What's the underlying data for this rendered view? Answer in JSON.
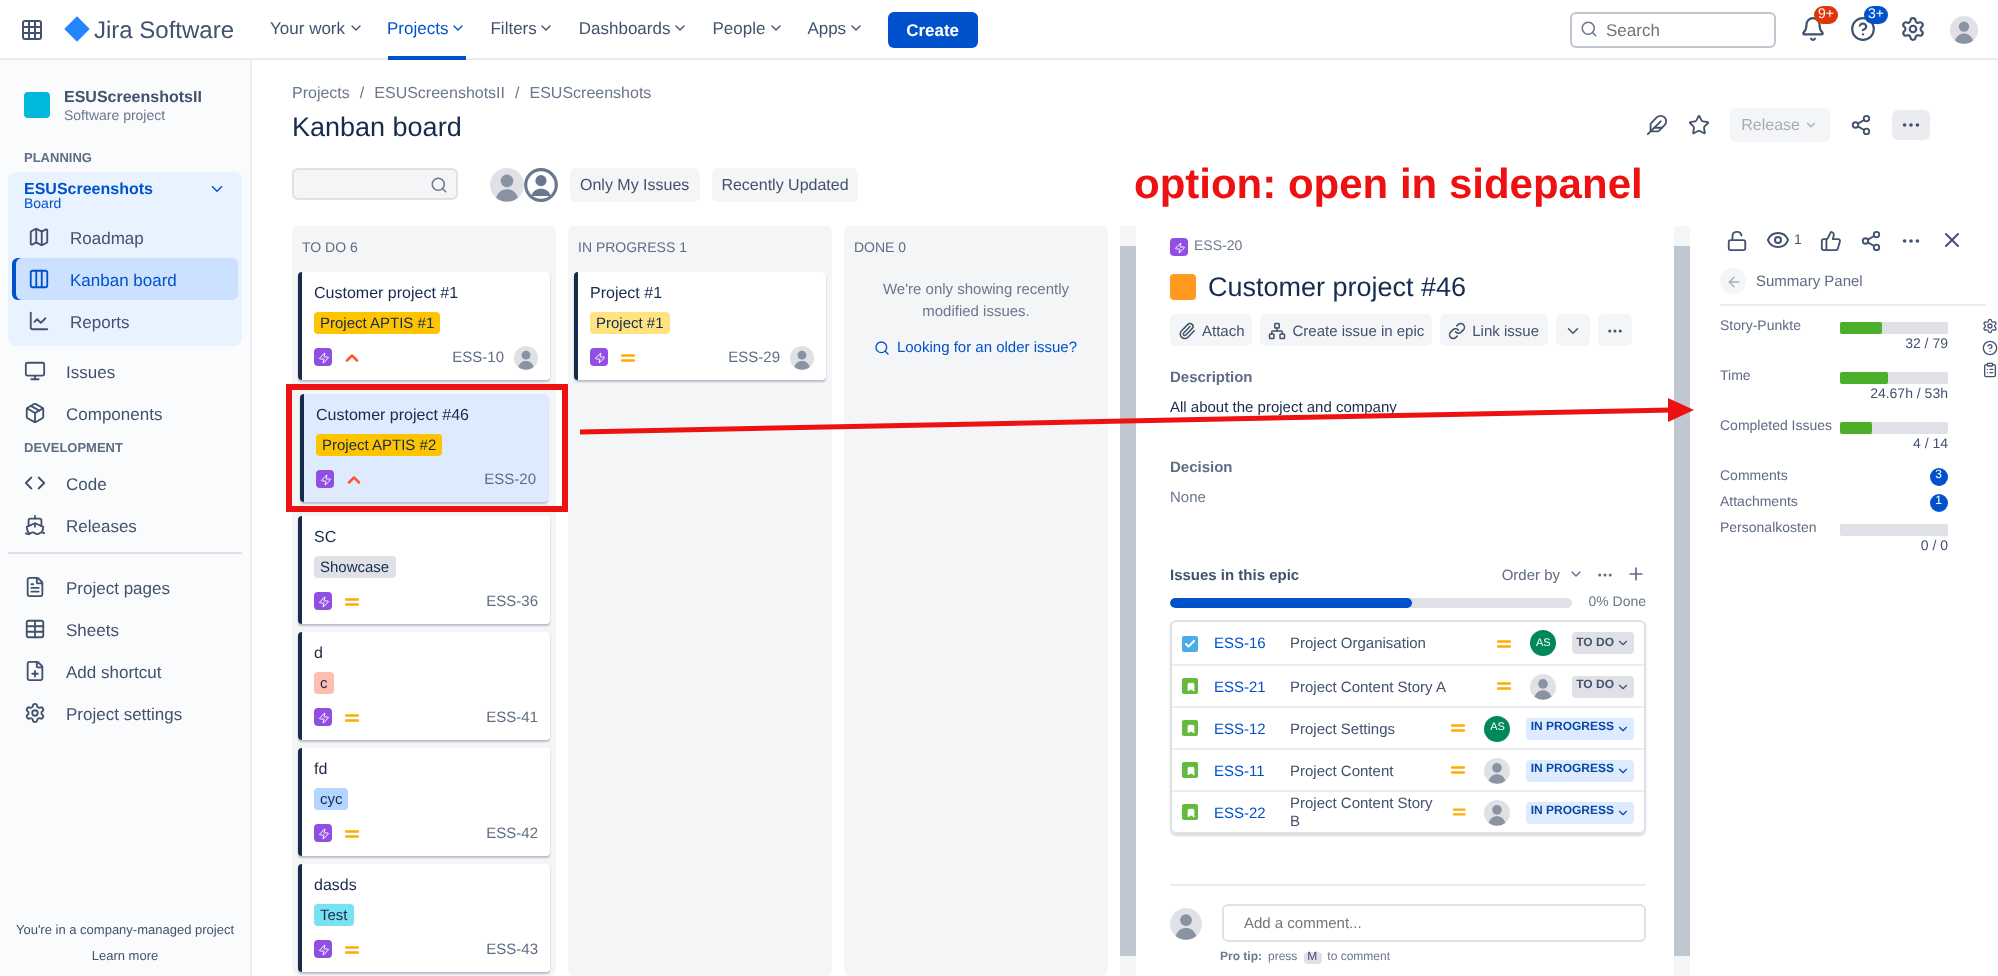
{
  "topnav": {
    "product": "Jira Software",
    "items": [
      {
        "label": "Your work",
        "selected": false
      },
      {
        "label": "Projects",
        "selected": true
      },
      {
        "label": "Filters",
        "selected": false
      },
      {
        "label": "Dashboards",
        "selected": false
      },
      {
        "label": "People",
        "selected": false
      },
      {
        "label": "Apps",
        "selected": false
      }
    ],
    "create": "Create",
    "search": {
      "placeholder": "Search"
    },
    "notifications_badge": "9+",
    "help_badge": "3+"
  },
  "sidebar": {
    "project": {
      "name": "ESUScreenshotsII",
      "type": "Software project"
    },
    "sections": [
      {
        "heading": "PLANNING",
        "group": {
          "title": "ESUScreenshots",
          "subtitle": "Board",
          "items": [
            {
              "label": "Roadmap",
              "selected": false
            },
            {
              "label": "Kanban board",
              "selected": true
            },
            {
              "label": "Reports",
              "selected": false
            }
          ]
        },
        "items": [
          {
            "label": "Issues",
            "selected": false
          },
          {
            "label": "Components",
            "selected": false
          }
        ]
      },
      {
        "heading": "DEVELOPMENT",
        "items": [
          {
            "label": "Code",
            "selected": false
          },
          {
            "label": "Releases",
            "selected": false
          }
        ]
      },
      {
        "items": [
          {
            "label": "Project pages",
            "selected": false
          },
          {
            "label": "Sheets",
            "selected": false
          },
          {
            "label": "Add shortcut",
            "selected": false
          },
          {
            "label": "Project settings",
            "selected": false
          }
        ]
      }
    ],
    "footer": {
      "text": "You're in a company-managed project",
      "link": "Learn more"
    }
  },
  "breadcrumbs": {
    "separator": "/",
    "items": [
      "Projects",
      "ESUScreenshotsII",
      "ESUScreenshots"
    ]
  },
  "title": "Kanban board",
  "header_actions": {
    "release": "Release"
  },
  "filters": [
    "Only My Issues",
    "Recently Updated"
  ],
  "annotation": {
    "text": "option: open in sidepanel"
  },
  "columns": [
    {
      "title": "TO DO 6",
      "cards": [
        {
          "title": "Customer project #1",
          "tag": {
            "label": "Project APTIS #1",
            "color": "#ffc400"
          },
          "high_priority": true,
          "key": "ESS-10",
          "assigned": true,
          "selected": false,
          "outlined": false
        },
        {
          "title": "Customer project #46",
          "tag": {
            "label": "Project APTIS #2",
            "color": "#ffc400"
          },
          "high_priority": true,
          "key": "ESS-20",
          "assigned": false,
          "selected": true,
          "outlined": true
        },
        {
          "title": "SC",
          "tag": {
            "label": "Showcase",
            "color": "#dfe1e6"
          },
          "high_priority": false,
          "key": "ESS-36",
          "assigned": false,
          "selected": false,
          "outlined": false
        },
        {
          "title": "d",
          "tag": {
            "label": "c",
            "color": "#ffbdad"
          },
          "high_priority": false,
          "key": "ESS-41",
          "assigned": false,
          "selected": false,
          "outlined": false
        },
        {
          "title": "fd",
          "tag": {
            "label": "cyc",
            "color": "#b3d4ff"
          },
          "high_priority": false,
          "key": "ESS-42",
          "assigned": false,
          "selected": false,
          "outlined": false
        },
        {
          "title": "dasds",
          "tag": {
            "label": "Test",
            "color": "#79e2f2"
          },
          "high_priority": false,
          "key": "ESS-43",
          "assigned": false,
          "selected": false,
          "outlined": false
        }
      ]
    },
    {
      "title": "IN PROGRESS 1",
      "cards": [
        {
          "title": "Project #1",
          "tag": {
            "label": "Project #1",
            "color": "#ffe380"
          },
          "high_priority": false,
          "key": "ESS-29",
          "assigned": true,
          "selected": false,
          "outlined": false
        }
      ]
    },
    {
      "title": "DONE 0",
      "empty": {
        "text": "We're only showing recently modified issues.",
        "link": "Looking for an older issue?"
      }
    }
  ],
  "detail": {
    "key": "ESS-20",
    "title": "Customer project #46",
    "actions": [
      "Attach",
      "Create issue in epic",
      "Link issue"
    ],
    "fields": [
      {
        "label": "Description",
        "value": "All about the project and company",
        "empty": false
      },
      {
        "label": "Decision",
        "value": "None",
        "empty": true
      }
    ],
    "epic": {
      "title": "Issues in this epic",
      "order_by": "Order by",
      "level": 0.6,
      "done": "0% Done",
      "issues": [
        {
          "kind": "task",
          "key": "ESS-16",
          "summary": "Project Organisation",
          "assignee": {
            "kind": "initials",
            "initials": "AS"
          },
          "status": {
            "label": "TO DO",
            "in_progress": false
          }
        },
        {
          "kind": "story",
          "key": "ESS-21",
          "summary": "Project Content Story A",
          "assignee": {
            "kind": "avatar"
          },
          "status": {
            "label": "TO DO",
            "in_progress": false
          }
        },
        {
          "kind": "story",
          "key": "ESS-12",
          "summary": "Project Settings",
          "assignee": {
            "kind": "initials",
            "initials": "AS"
          },
          "status": {
            "label": "IN PROGRESS",
            "in_progress": true
          }
        },
        {
          "kind": "story",
          "key": "ESS-11",
          "summary": "Project Content",
          "assignee": {
            "kind": "avatar"
          },
          "status": {
            "label": "IN PROGRESS",
            "in_progress": true
          }
        },
        {
          "kind": "story",
          "key": "ESS-22",
          "summary": "Project Content Story B",
          "assignee": {
            "kind": "avatar"
          },
          "status": {
            "label": "IN PROGRESS",
            "in_progress": true
          }
        }
      ]
    },
    "comment": {
      "placeholder": "Add a comment...",
      "tip_label": "Pro tip:",
      "tip_pre": "press",
      "tip_key": "M",
      "tip_post": "to comment"
    }
  },
  "summary": {
    "watchers": "1",
    "title": "Summary Panel",
    "metrics": [
      {
        "kind": "bar",
        "label": "Story-Punkte",
        "level": 0.38,
        "reading": "32 / 79"
      },
      {
        "kind": "bar",
        "label": "Time",
        "level": 0.44,
        "reading": "24.67h / 53h"
      },
      {
        "kind": "bar",
        "label": "Completed Issues",
        "level": 0.29,
        "reading": "4 / 14"
      },
      {
        "kind": "badge",
        "label": "Comments",
        "count": "3"
      },
      {
        "kind": "badge",
        "label": "Attachments",
        "count": "1"
      },
      {
        "kind": "bar",
        "label": "Personalkosten",
        "level": 0,
        "reading": "0 / 0"
      }
    ]
  }
}
